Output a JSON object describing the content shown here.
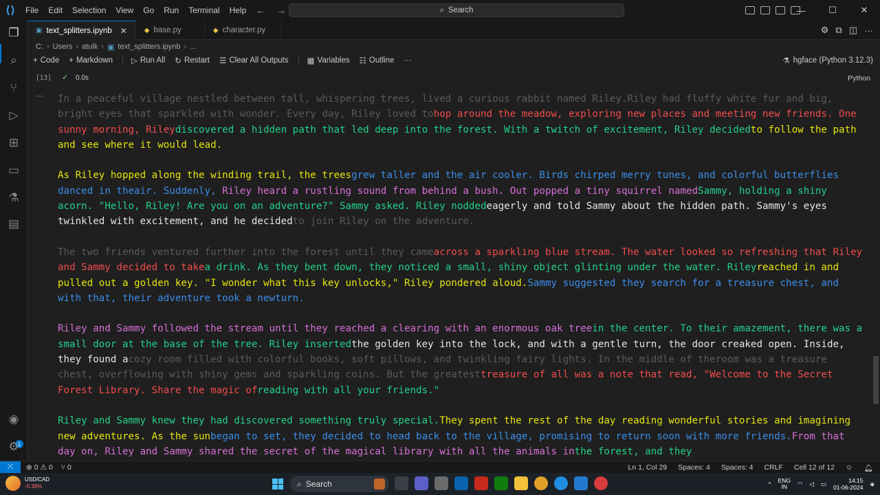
{
  "menu": [
    "File",
    "Edit",
    "Selection",
    "View",
    "Go",
    "Run",
    "Terminal",
    "Help"
  ],
  "search_label": "Search",
  "tabs": [
    {
      "label": "text_splitters.ipynb",
      "active": true
    },
    {
      "label": "base.py",
      "active": false
    },
    {
      "label": "character.py",
      "active": false
    }
  ],
  "breadcrumb": [
    "C:",
    "Users",
    "atulk",
    "text_splitters.ipynb",
    "..."
  ],
  "toolbar": {
    "code": "Code",
    "markdown": "Markdown",
    "run_all": "Run All",
    "restart": "Restart",
    "clear_outputs": "Clear All Outputs",
    "variables": "Variables",
    "outline": "Outline",
    "more": "···"
  },
  "kernel": "hgface (Python 3.12.3)",
  "cell": {
    "exec_count": "[13]",
    "timing": "0.0s",
    "language": "Python"
  },
  "colors": {
    "gray": "#5a5a5a",
    "red": "#f14c4c",
    "green": "#23d18b",
    "yellow": "#e5e510",
    "blue": "#3b8eea",
    "magenta": "#d670d6",
    "white": "#e5e5e5",
    "accent": "#0078d4"
  },
  "output_paragraphs": [
    [
      {
        "c": "gray",
        "t": "In a peaceful village nestled between tall, whispering trees, lived a curious rabbit named Riley.Riley had fluffy white fur and big, bright eyes that sparkled with wonder. Every day, Riley loved to"
      },
      {
        "c": "red",
        "t": "hop around the meadow, exploring new places and meeting new friends. One sunny morning, Riley"
      },
      {
        "c": "green",
        "t": "discovered a hidden path that led deep into the forest. With a twitch of excitement, Riley decided"
      },
      {
        "c": "yellow",
        "t": "to follow the path and see where it would lead."
      }
    ],
    [
      {
        "c": "yellow",
        "t": "As Riley hopped along the winding trail, the trees"
      },
      {
        "c": "blue",
        "t": "grew taller and the air cooler. Birds chirped merry tunes, and colorful butterflies danced in theair. Suddenly, "
      },
      {
        "c": "magenta",
        "t": "Riley heard a rustling sound from behind a bush. Out popped a tiny squirrel named"
      },
      {
        "c": "green",
        "t": "Sammy, holding a shiny acorn. \"Hello, Riley! Are you on an adventure?\" Sammy asked. Riley nodded"
      },
      {
        "c": "white",
        "t": "eagerly and told Sammy about the hidden path. Sammy's eyes twinkled with excitement, and he decided"
      },
      {
        "c": "gray",
        "t": "to join Riley on the adventure."
      }
    ],
    [
      {
        "c": "gray",
        "t": "The two friends ventured further into the forest until they came"
      },
      {
        "c": "red",
        "t": "across a sparkling blue stream. The water looked so refreshing that Riley and Sammy decided to take"
      },
      {
        "c": "green",
        "t": "a drink. As they bent down, they noticed a small, shiny object glinting under the water. Riley"
      },
      {
        "c": "yellow",
        "t": "reached in and pulled out a golden key. \"I wonder what this key unlocks,\" Riley pondered aloud."
      },
      {
        "c": "blue",
        "t": "Sammy suggested they search for a treasure chest, and with that, their adventure took a newturn."
      }
    ],
    [
      {
        "c": "magenta",
        "t": "Riley and Sammy followed the stream until they reached a clearing with an enormous oak tree"
      },
      {
        "c": "green",
        "t": "in the center. To their amazement, there was a small door at the base of the tree. Riley inserted"
      },
      {
        "c": "white",
        "t": "the golden key into the lock, and with a gentle turn, the door creaked open. Inside, they found a"
      },
      {
        "c": "gray",
        "t": "cozy room filled with colorful books, soft pillows, and twinkling fairy lights. In the middle of theroom was a treasure chest, overflowing with shiny gems and sparkling coins. But the greatest"
      },
      {
        "c": "red",
        "t": "treasure of all was a note that read, \"Welcome to the Secret Forest Library. Share the magic of"
      },
      {
        "c": "green",
        "t": "reading with all your friends.\""
      }
    ],
    [
      {
        "c": "green",
        "t": "Riley and Sammy knew they had discovered something truly special."
      },
      {
        "c": "yellow",
        "t": "They spent the rest of the day reading wonderful stories and imagining new adventures. As the sun"
      },
      {
        "c": "blue",
        "t": "began to set, they decided to head back to the village, promising to return soon with more friends."
      },
      {
        "c": "magenta",
        "t": "From that day on, Riley and Sammy shared the secret of the magical library with all the animals in"
      },
      {
        "c": "green",
        "t": "the forest, and they"
      }
    ]
  ],
  "statusbar": {
    "errors": "0",
    "warnings": "0",
    "ports": "0",
    "position": "Ln 1, Col 29",
    "spaces1": "Spaces: 4",
    "spaces2": "Spaces: 4",
    "eol": "CRLF",
    "cell_pos": "Cell 12 of 12"
  },
  "taskbar": {
    "weather_title": "USD/CAD",
    "weather_value": "-0.38%",
    "search": "Search",
    "lang_top": "ENG",
    "lang_bottom": "IN",
    "time": "14:15",
    "date": "01-06-2024"
  }
}
